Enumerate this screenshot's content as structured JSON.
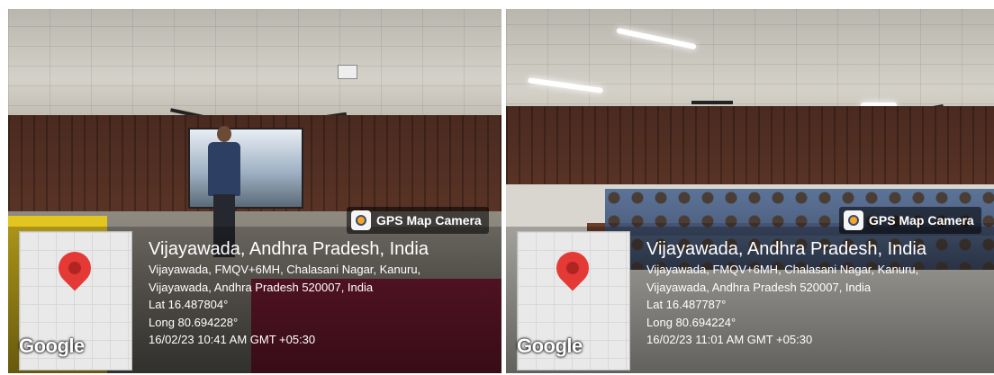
{
  "photos": [
    {
      "badge": "GPS Map Camera",
      "title": "Vijayawada, Andhra Pradesh, India",
      "address_1": "Vijayawada, FMQV+6MH, Chalasani Nagar, Kanuru,",
      "address_2": "Vijayawada, Andhra Pradesh 520007, India",
      "lat": "Lat 16.487804°",
      "long": "Long 80.694228°",
      "timestamp": "16/02/23 10:41 AM GMT +05:30",
      "logo": "Google"
    },
    {
      "badge": "GPS Map Camera",
      "title": "Vijayawada, Andhra Pradesh, India",
      "address_1": "Vijayawada, FMQV+6MH, Chalasani Nagar, Kanuru,",
      "address_2": "Vijayawada, Andhra Pradesh 520007, India",
      "lat": "Lat 16.487787°",
      "long": "Long 80.694224°",
      "timestamp": "16/02/23 11:01 AM GMT +05:30",
      "logo": "Google"
    }
  ],
  "colors": {
    "pin": "#e53935",
    "badge_accent": "#f6a623"
  }
}
